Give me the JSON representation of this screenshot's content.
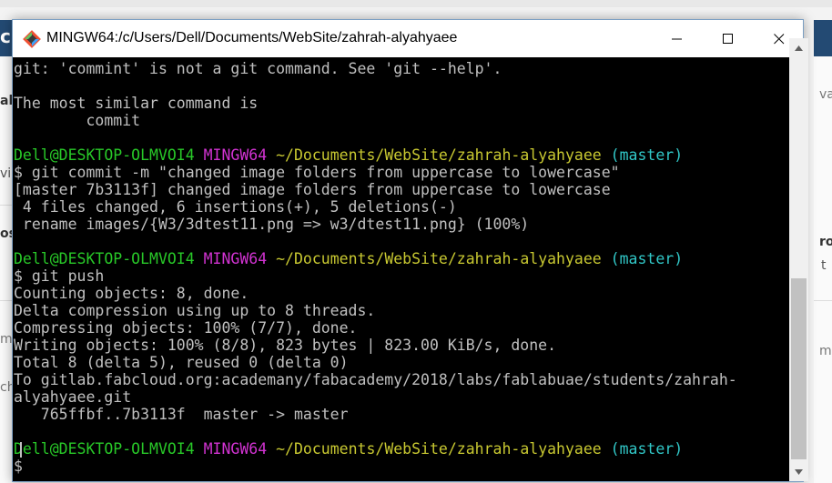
{
  "window": {
    "title": "MINGW64:/c/Users/Dell/Documents/WebSite/zahrah-alyahyaee",
    "buttons": {
      "minimize": "—",
      "maximize": "☐",
      "close": "✕"
    }
  },
  "background": {
    "frag_top_left": "cl",
    "frag_left_1": "ah",
    "frag_left_2": "vi",
    "frag_left_3": "os",
    "frag_left_4": "m",
    "frag_left_5": "ch",
    "frag_right_1": "va",
    "frag_right_2": "ro",
    "frag_right_3": "t",
    "frag_right_4": "m"
  },
  "terminal": {
    "lines": [
      {
        "segments": [
          {
            "text": "git: 'commint' is not a git command. See 'git --help'.",
            "color": "default"
          }
        ]
      },
      {
        "segments": [
          {
            "text": "",
            "color": "default"
          }
        ]
      },
      {
        "segments": [
          {
            "text": "The most similar command is",
            "color": "default"
          }
        ]
      },
      {
        "segments": [
          {
            "text": "        commit",
            "color": "default"
          }
        ]
      },
      {
        "segments": [
          {
            "text": "",
            "color": "default"
          }
        ]
      },
      {
        "segments": [
          {
            "text": "Dell@DESKTOP-OLMVOI4 ",
            "color": "green"
          },
          {
            "text": "MINGW64 ",
            "color": "magenta"
          },
          {
            "text": "~/Documents/WebSite/zahrah-alyahyaee ",
            "color": "yellow"
          },
          {
            "text": "(master)",
            "color": "cyan"
          }
        ]
      },
      {
        "segments": [
          {
            "text": "$ git commit -m \"changed image folders from uppercase to lowercase\"",
            "color": "default"
          }
        ]
      },
      {
        "segments": [
          {
            "text": "[master 7b3113f] changed image folders from uppercase to lowercase",
            "color": "default"
          }
        ]
      },
      {
        "segments": [
          {
            "text": " 4 files changed, 6 insertions(+), 5 deletions(-)",
            "color": "default"
          }
        ]
      },
      {
        "segments": [
          {
            "text": " rename images/{W3/3dtest11.png => w3/dtest11.png} (100%)",
            "color": "default"
          }
        ]
      },
      {
        "segments": [
          {
            "text": "",
            "color": "default"
          }
        ]
      },
      {
        "segments": [
          {
            "text": "Dell@DESKTOP-OLMVOI4 ",
            "color": "green"
          },
          {
            "text": "MINGW64 ",
            "color": "magenta"
          },
          {
            "text": "~/Documents/WebSite/zahrah-alyahyaee ",
            "color": "yellow"
          },
          {
            "text": "(master)",
            "color": "cyan"
          }
        ]
      },
      {
        "segments": [
          {
            "text": "$ git push",
            "color": "default"
          }
        ]
      },
      {
        "segments": [
          {
            "text": "Counting objects: 8, done.",
            "color": "default"
          }
        ]
      },
      {
        "segments": [
          {
            "text": "Delta compression using up to 8 threads.",
            "color": "default"
          }
        ]
      },
      {
        "segments": [
          {
            "text": "Compressing objects: 100% (7/7), done.",
            "color": "default"
          }
        ]
      },
      {
        "segments": [
          {
            "text": "Writing objects: 100% (8/8), 823 bytes | 823.00 KiB/s, done.",
            "color": "default"
          }
        ]
      },
      {
        "segments": [
          {
            "text": "Total 8 (delta 5), reused 0 (delta 0)",
            "color": "default"
          }
        ]
      },
      {
        "segments": [
          {
            "text": "To gitlab.fabcloud.org:academany/fabacademy/2018/labs/fablabuae/students/zahrah-",
            "color": "default"
          }
        ]
      },
      {
        "segments": [
          {
            "text": "alyahyaee.git",
            "color": "default"
          }
        ]
      },
      {
        "segments": [
          {
            "text": "   765ffbf..7b3113f  master -> master",
            "color": "default"
          }
        ]
      },
      {
        "segments": [
          {
            "text": "",
            "color": "default"
          }
        ]
      },
      {
        "segments": [
          {
            "text": "Dell@DESKTOP-OLMVOI4 ",
            "color": "green"
          },
          {
            "text": "MINGW64 ",
            "color": "magenta"
          },
          {
            "text": "~/Documents/WebSite/zahrah-alyahyaee ",
            "color": "yellow"
          },
          {
            "text": "(master)",
            "color": "cyan"
          }
        ]
      },
      {
        "segments": [
          {
            "text": "$ ",
            "color": "default"
          }
        ]
      }
    ]
  },
  "colors": {
    "default": "#c0c0c0",
    "green": "#28c828",
    "magenta": "#d233d2",
    "yellow": "#c8c831",
    "cyan": "#31c8c8",
    "background": "#000000"
  },
  "icons": {
    "app": "git-bash-icon",
    "scroll_up": "triangle-up-icon",
    "scroll_down": "triangle-down-icon"
  }
}
